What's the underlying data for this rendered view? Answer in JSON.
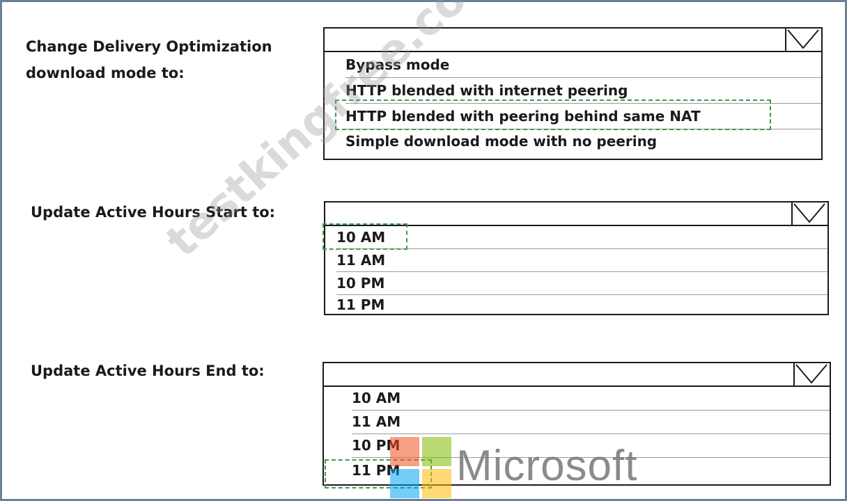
{
  "questions": [
    {
      "label_line1": "Change Delivery Optimization",
      "label_line2": "download mode to:",
      "options": [
        "Bypass mode",
        "HTTP blended with internet peering",
        "HTTP blended with peering behind same NAT",
        "Simple download mode with no peering"
      ],
      "selected_index": 2
    },
    {
      "label": "Update Active Hours Start to:",
      "options": [
        "10 AM",
        "11 AM",
        "10 PM",
        "11 PM"
      ],
      "selected_index": 0
    },
    {
      "label": "Update Active Hours End to:",
      "options": [
        "10 AM",
        "11 AM",
        "10 PM",
        "11 PM"
      ],
      "selected_index": 3
    }
  ],
  "watermark": "testkingfree.com",
  "logo": {
    "word": "Microsoft",
    "colors": [
      "#f25022",
      "#7fba00",
      "#00a4ef",
      "#ffb900"
    ]
  },
  "colors": {
    "selection_outline": "#3e9a4f",
    "frame_border": "#6b7f95"
  }
}
